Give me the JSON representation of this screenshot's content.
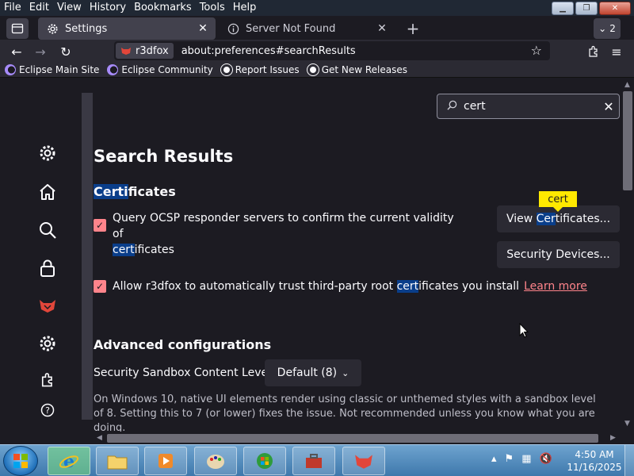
{
  "menu": [
    "File",
    "Edit",
    "View",
    "History",
    "Bookmarks",
    "Tools",
    "Help"
  ],
  "tabs": [
    {
      "title": "Settings",
      "active": true,
      "icon": "gear-icon"
    },
    {
      "title": "Server Not Found",
      "active": false,
      "icon": "info-icon"
    }
  ],
  "tab_count": "2",
  "urlbar": {
    "identity": "r3dfox",
    "url": "about:preferences#searchResults"
  },
  "bookmarks": [
    "Eclipse Main Site",
    "Eclipse Community",
    "Report Issues",
    "Get New Releases"
  ],
  "search": {
    "value": "cert"
  },
  "page": {
    "heading": "Search Results",
    "section_hl": "Certi",
    "section_rest": "ficates",
    "ocsp_a": "Query OCSP responder servers to confirm the current validity of",
    "ocsp_hl": "cert",
    "ocsp_b": "ificates",
    "trust_a": "Allow r3dfox to automatically trust third-party root ",
    "trust_hl": "cert",
    "trust_b": "ificates you install",
    "learn_more": "Learn more",
    "btn_view_a": "View ",
    "btn_view_hl": "Cer",
    "btn_view_b": "tificates...",
    "btn_devices": "Security Devices...",
    "tooltip": "cert",
    "adv_heading": "Advanced configurations",
    "sandbox_label": "Security Sandbox Content Level",
    "sandbox_value": "Default (8)",
    "desc": "On Windows 10, native UI elements render using classic or unthemed styles with a sandbox level of 8. Setting this to 7 (or lower) fixes the issue. Not recommended unless you know what you are doing."
  },
  "clock": {
    "time": "4:50 AM",
    "date": "11/16/2025"
  },
  "colors": {
    "accent": "#ff848b",
    "highlight": "#0a3e8a",
    "tooltip": "#ffe900"
  }
}
